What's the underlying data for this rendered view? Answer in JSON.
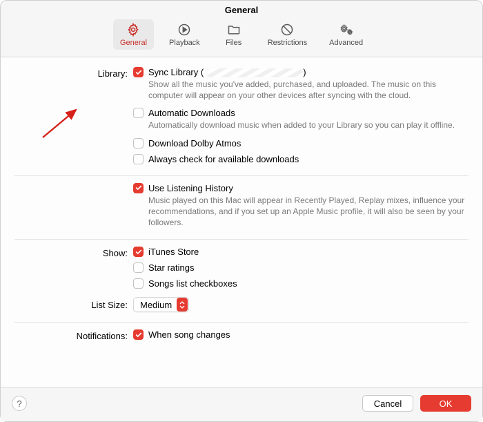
{
  "window_title": "General",
  "tabs": [
    {
      "label": "General",
      "icon": "gear-icon"
    },
    {
      "label": "Playback",
      "icon": "play-circle-icon"
    },
    {
      "label": "Files",
      "icon": "folder-icon"
    },
    {
      "label": "Restrictions",
      "icon": "restrict-icon"
    },
    {
      "label": "Advanced",
      "icon": "gears-icon"
    }
  ],
  "labels": {
    "library": "Library:",
    "show": "Show:",
    "list_size": "List Size:",
    "notifications": "Notifications:"
  },
  "library": {
    "sync": {
      "label": "Sync Library",
      "lparen": "(",
      "rparen": ")",
      "checked": true,
      "desc": "Show all the music you've added, purchased, and uploaded. The music on this computer will appear on your other devices after syncing with the cloud."
    },
    "auto_dl": {
      "label": "Automatic Downloads",
      "checked": false,
      "desc": "Automatically download music when added to your Library so you can play it offline."
    },
    "dolby": {
      "label": "Download Dolby Atmos",
      "checked": false
    },
    "check_dl": {
      "label": "Always check for available downloads",
      "checked": false
    }
  },
  "history": {
    "use": {
      "label": "Use Listening History",
      "checked": true,
      "desc": "Music played on this Mac will appear in Recently Played, Replay mixes, influence your recommendations, and if you set up an Apple Music profile, it will also be seen by your followers."
    }
  },
  "show": {
    "itunes": {
      "label": "iTunes Store",
      "checked": true
    },
    "star": {
      "label": "Star ratings",
      "checked": false
    },
    "checkboxes": {
      "label": "Songs list checkboxes",
      "checked": false
    }
  },
  "list_size": {
    "value": "Medium"
  },
  "notifications": {
    "song_changes": {
      "label": "When song changes",
      "checked": true
    }
  },
  "buttons": {
    "help": "?",
    "cancel": "Cancel",
    "ok": "OK"
  },
  "colors": {
    "accent": "#e63b30"
  }
}
